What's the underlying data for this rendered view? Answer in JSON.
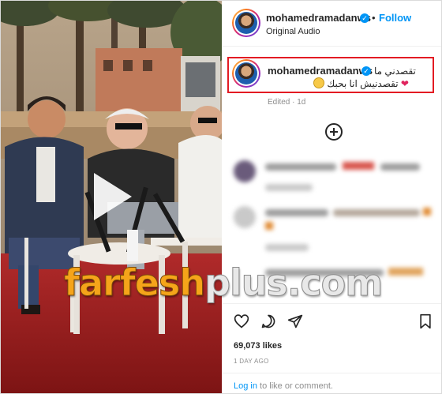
{
  "post": {
    "username": "mohamedramadanws",
    "follow_label": "Follow",
    "audio": "Original Audio",
    "caption_line1": "تقصدني ما",
    "caption_line2": "تقصدنيش انا بحبك",
    "edited": "Edited · 1d",
    "likes": "69,073 likes",
    "date": "1 DAY AGO"
  },
  "login": {
    "link": "Log in",
    "rest": " to like or comment."
  },
  "watermark": {
    "part1": "farfesh",
    "part2": "plus.com"
  },
  "icons": {
    "verified": "verified-badge-icon",
    "add_comments": "plus-circle-icon",
    "like": "heart-icon",
    "comment": "comment-icon",
    "share": "paper-plane-icon",
    "save": "bookmark-icon",
    "play": "play-icon"
  },
  "colors": {
    "accent": "#0095f6",
    "highlight_box": "#e31b23",
    "watermark_orange": "#f5a41a"
  }
}
